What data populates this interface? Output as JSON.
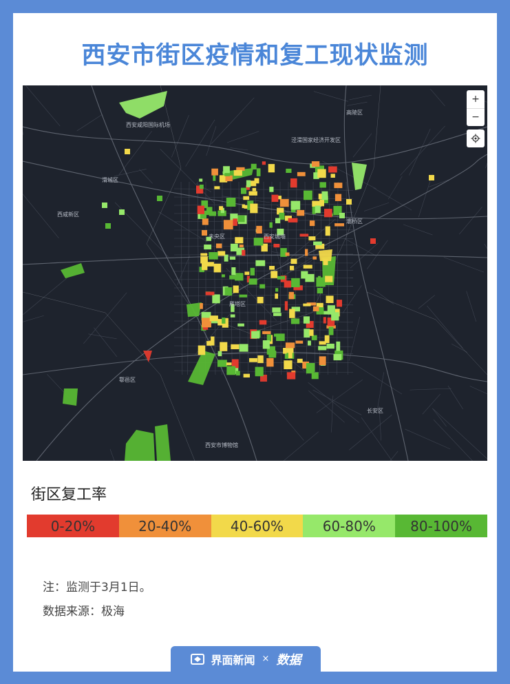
{
  "title": "西安市街区疫情和复工现状监测",
  "map": {
    "zoom_in": "+",
    "zoom_out": "−",
    "locate_icon": "locate-icon",
    "place_labels": [
      "西安咸阳国际机场",
      "渭城区",
      "泾渭国家经济开发区",
      "高陵区",
      "西咸新区",
      "未央区",
      "灞桥区",
      "西安城墙",
      "雁塔区",
      "长安区",
      "鄠邑区",
      "西安市博物馆"
    ]
  },
  "legend": {
    "title": "街区复工率",
    "items": [
      {
        "label": "0-20%",
        "color": "#e23b2e"
      },
      {
        "label": "20-40%",
        "color": "#f0903a"
      },
      {
        "label": "40-60%",
        "color": "#f2d94a"
      },
      {
        "label": "60-80%",
        "color": "#96e86a"
      },
      {
        "label": "80-100%",
        "color": "#58b834"
      }
    ]
  },
  "note": "注：监测于3月1日。",
  "source": "数据来源：极海",
  "footer": {
    "brand": "界面新闻",
    "times": "×",
    "partner": "数据"
  }
}
